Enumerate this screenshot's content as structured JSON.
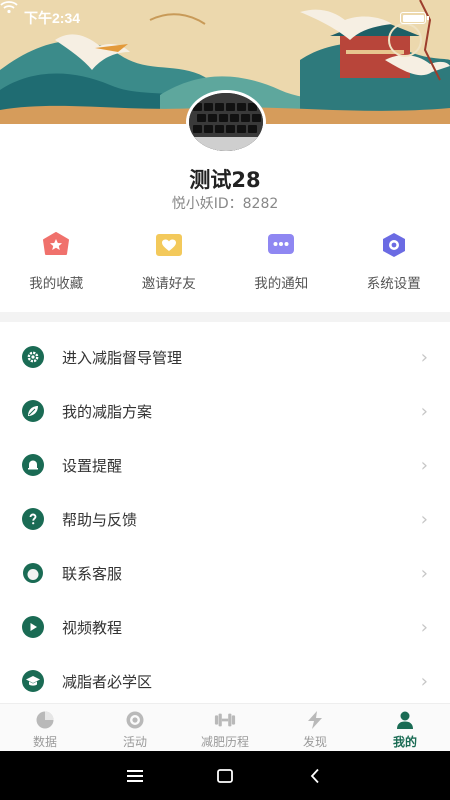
{
  "status_bar": {
    "time": "下午2:34",
    "battery": "100"
  },
  "profile": {
    "name": "测试28",
    "id_text": "悦小妖ID：8282"
  },
  "quick_actions": [
    {
      "label": "我的收藏",
      "icon": "star-icon",
      "color": "#f0716c"
    },
    {
      "label": "邀请好友",
      "icon": "heart-card-icon",
      "color": "#f3c95b"
    },
    {
      "label": "我的通知",
      "icon": "message-icon",
      "color": "#8f87f2"
    },
    {
      "label": "系统设置",
      "icon": "settings-eye-icon",
      "color": "#6b6be3"
    }
  ],
  "menu": [
    {
      "label": "进入减脂督导管理",
      "icon": "gear-icon"
    },
    {
      "label": "我的减脂方案",
      "icon": "leaf-icon"
    },
    {
      "label": "设置提醒",
      "icon": "bell-icon"
    },
    {
      "label": "帮助与反馈",
      "icon": "question-icon"
    },
    {
      "label": "联系客服",
      "icon": "headset-icon"
    },
    {
      "label": "视频教程",
      "icon": "play-icon"
    },
    {
      "label": "减脂者必学区",
      "icon": "graduation-cap-icon"
    }
  ],
  "tabs": [
    {
      "label": "数据",
      "icon": "pie-chart-icon",
      "active": false
    },
    {
      "label": "活动",
      "icon": "target-icon",
      "active": false
    },
    {
      "label": "减肥历程",
      "icon": "dumbbell-icon",
      "active": false
    },
    {
      "label": "发现",
      "icon": "lightning-icon",
      "active": false
    },
    {
      "label": "我的",
      "icon": "person-icon",
      "active": true
    }
  ],
  "colors": {
    "accent": "#1a6b54",
    "inactive": "#9a9a9a"
  }
}
